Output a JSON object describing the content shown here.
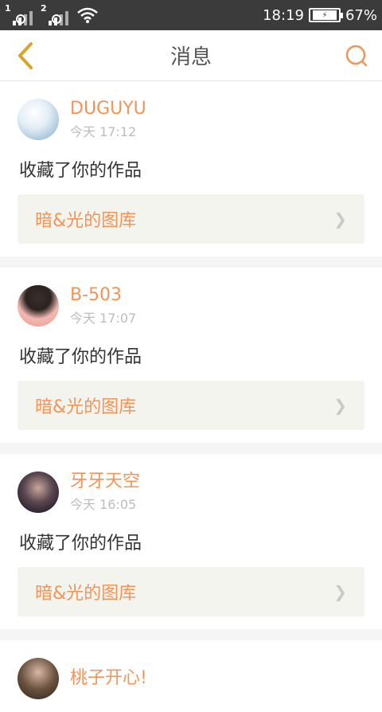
{
  "status": {
    "sim1": "1",
    "sim2": "2",
    "time": "18:19",
    "battery": "67%"
  },
  "topbar": {
    "title": "消息",
    "back_icon": "chevron-left-icon",
    "search_icon": "search-icon"
  },
  "messages": [
    {
      "name": "DUGUYU",
      "time": "今天 17:12",
      "action": "收藏了你的作品",
      "item": "暗&光的图库"
    },
    {
      "name": "B-503",
      "time": "今天 17:07",
      "action": "收藏了你的作品",
      "item": "暗&光的图库"
    },
    {
      "name": "牙牙天空",
      "time": "今天 16:05",
      "action": "收藏了你的作品",
      "item": "暗&光的图库"
    },
    {
      "name": "桃子开心!",
      "time": "",
      "action": "",
      "item": ""
    }
  ],
  "colors": {
    "accent": "#f0955a",
    "header_bg": "#3b3b3b"
  }
}
